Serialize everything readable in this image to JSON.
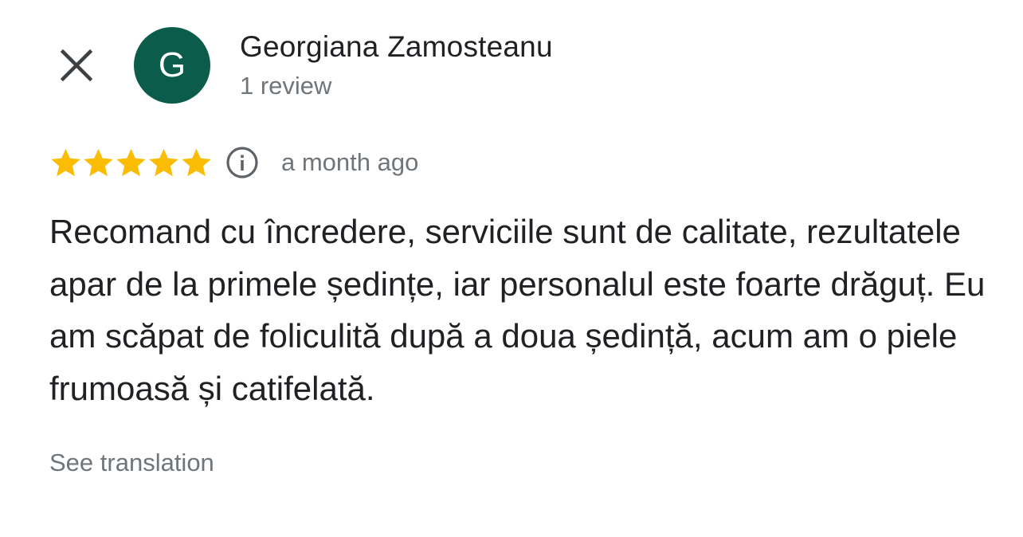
{
  "header": {
    "close_icon": "close-icon",
    "avatar": {
      "initial": "G",
      "color": "#0b5c4a"
    },
    "reviewer_name": "Georgiana Zamosteanu",
    "review_count": "1 review"
  },
  "rating": {
    "stars": 5,
    "max_stars": 5,
    "star_color": "#fbbc04",
    "star_icon": "star-icon",
    "info_icon": "info-icon",
    "time_ago": "a month ago"
  },
  "review": {
    "text": "Recomand cu încredere, serviciile sunt de calitate, rezultatele apar de la primele ședințe, iar personalul este foarte drăguț. Eu am scăpat de foliculită după a doua ședință, acum am o piele frumoasă și catifelată."
  },
  "actions": {
    "see_translation": "See translation"
  }
}
